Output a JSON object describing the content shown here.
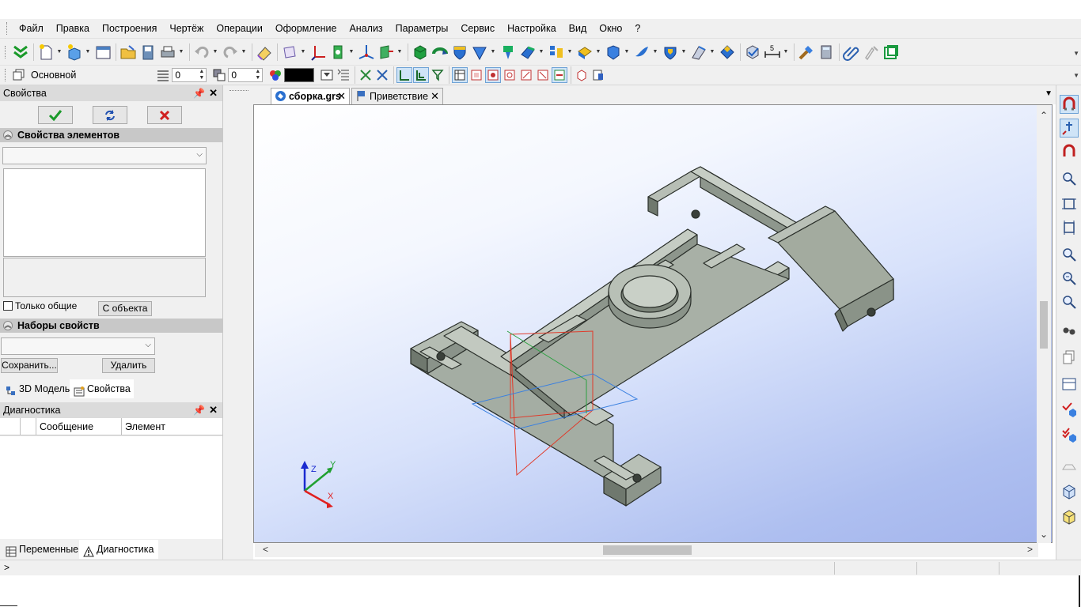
{
  "menu": {
    "items": [
      "Файл",
      "Правка",
      "Построения",
      "Чертёж",
      "Операции",
      "Оформление",
      "Анализ",
      "Параметры",
      "Сервис",
      "Настройка",
      "Вид",
      "Окно",
      "?"
    ]
  },
  "toolbar2": {
    "layer_label": "Основной",
    "spin1_value": "0",
    "spin2_value": "0",
    "color": "#000000"
  },
  "properties_panel": {
    "title": "Свойства",
    "elements_section": "Свойства элементов",
    "only_common_label": "Только общие",
    "from_object_button": "С объекта",
    "sets_section": "Наборы свойств",
    "save_button": "Сохранить...",
    "delete_button": "Удалить",
    "tabs": [
      "3D Модель",
      "Свойства"
    ]
  },
  "diagnostics_panel": {
    "title": "Диагностика",
    "columns": [
      "Сообщение",
      "Элемент"
    ],
    "tabs": [
      "Переменные",
      "Диагностика"
    ]
  },
  "document_tabs": [
    {
      "label": "сборка.grs",
      "active": true
    },
    {
      "label": "Приветствие",
      "active": false
    }
  ],
  "axes": {
    "x": "X",
    "y": "Y",
    "z": "Z"
  },
  "status": {
    "prompt": ">"
  },
  "colors": {
    "accent": "#6fa3d6",
    "model": "#8f998e",
    "model_edge": "#2a2f2a"
  }
}
